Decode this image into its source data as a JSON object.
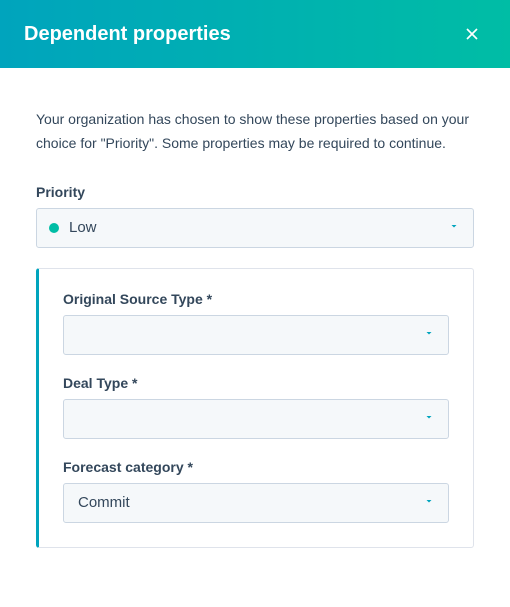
{
  "header": {
    "title": "Dependent properties"
  },
  "description": "Your organization has chosen to show these properties based on your choice for \"Priority\". Some properties may be required to continue.",
  "priority": {
    "label": "Priority",
    "value": "Low"
  },
  "dependentFields": [
    {
      "label": "Original Source Type *",
      "value": ""
    },
    {
      "label": "Deal Type *",
      "value": ""
    },
    {
      "label": "Forecast category *",
      "value": "Commit"
    }
  ]
}
